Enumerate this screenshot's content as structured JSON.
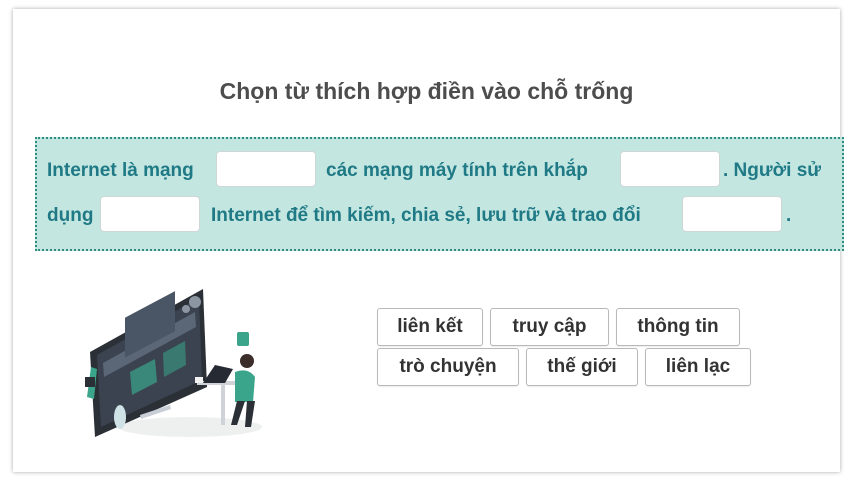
{
  "title": "Chọn từ thích hợp điền vào chỗ trống",
  "passage": {
    "seg1": "Internet là mạng",
    "seg2": "các mạng máy tính trên khắp",
    "seg3": ". Người sử",
    "seg4": "dụng",
    "seg5": "Internet để tìm kiếm, chia sẻ, lưu trữ và trao đổi",
    "seg6": "."
  },
  "choices": [
    "liên kết",
    "truy cập",
    "thông tin",
    "trò chuyện",
    "thế giới",
    "liên lạc"
  ],
  "colors": {
    "passage_bg": "#c3e6e1",
    "passage_border": "#2f8d7f",
    "passage_text": "#1f7a86",
    "accent": "#3aa58a"
  },
  "illustration_icon": "person-at-computer-illustration"
}
